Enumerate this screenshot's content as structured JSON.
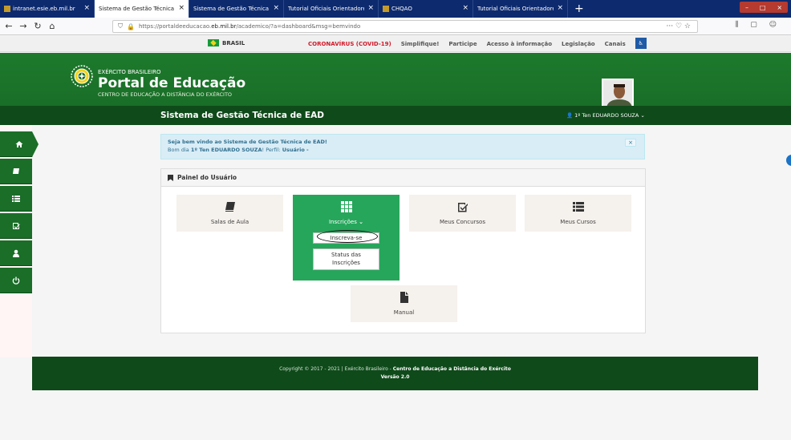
{
  "browser": {
    "tabs": [
      {
        "label": "intranet.esie.eb.mil.br",
        "active": false
      },
      {
        "label": "Sistema de Gestão Técnica de EAD",
        "active": true
      },
      {
        "label": "Sistema de Gestão Técnica de EAD",
        "active": false
      },
      {
        "label": "Tutorial Oficiais Orientadores - CHQ",
        "active": false
      },
      {
        "label": "CHQAO",
        "active": false
      },
      {
        "label": "Tutorial Oficiais Orientadores - CHQ",
        "active": false
      }
    ],
    "new_tab": "+",
    "url_prefix": "https://portaldeeducacao.",
    "url_domain": "eb.mil.br",
    "url_suffix": "/academico/?a=dashboard&msg=bemvindo",
    "url_actions": "··· ♡ ☆",
    "toolbar_right": "⫼ ▢ ☺"
  },
  "govbar": {
    "brasil": "BRASIL",
    "links": [
      "CORONAVÍRUS (COVID-19)",
      "Simplifique!",
      "Participe",
      "Acesso à informação",
      "Legislação",
      "Canais"
    ]
  },
  "header": {
    "org": "EXÉRCITO BRASILEIRO",
    "title": "Portal de Educação",
    "subtitle": "CENTRO DE EDUCAÇÃO A DISTÂNCIA DO EXÉRCITO"
  },
  "subheader": {
    "system_title": "Sistema de Gestão Técnica de EAD",
    "user": "1º Ten EDUARDO SOUZA"
  },
  "alert": {
    "line1": "Seja bem vindo ao Sistema de Gestão Técnica de EAD!",
    "greeting": "Bom dia",
    "user": "1º Ten EDUARDO SOUZA",
    "profile_label": "! Perfil:",
    "profile_value": "Usuário -",
    "close": "×"
  },
  "panel": {
    "title": "Painel do Usuário",
    "tiles": {
      "salas": "Salas de Aula",
      "inscricoes": "Inscrições",
      "concursos": "Meus Concursos",
      "cursos": "Meus Cursos",
      "manual": "Manual"
    },
    "dropdown": {
      "inscreva": "Inscreva-se",
      "status_line1": "Status das",
      "status_line2": "Inscrições"
    }
  },
  "footer": {
    "copyright": "Copyright © 2017 - 2021 | Exército Brasileiro - ",
    "center": "Centro de Educação a Distância do Exército",
    "version": "Versão 2.0"
  }
}
